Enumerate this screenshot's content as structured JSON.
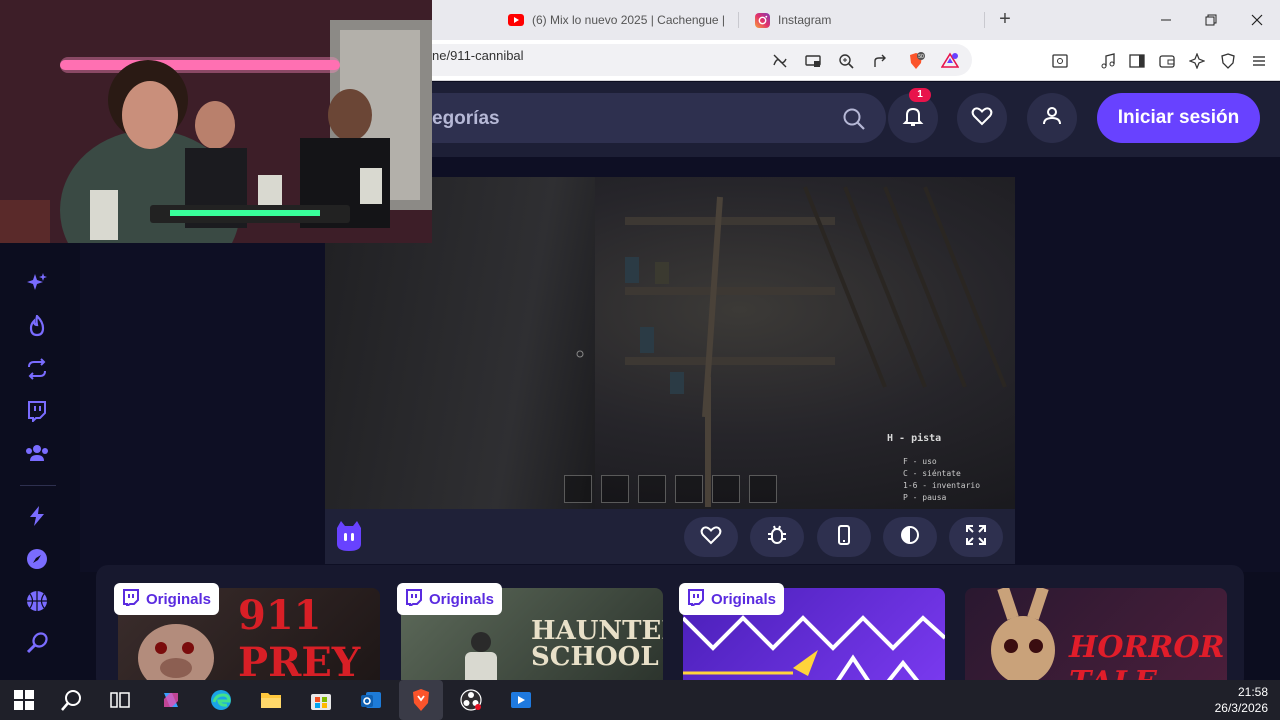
{
  "browser": {
    "tabs": [
      {
        "label": "(6) Mix lo nuevo 2025 | Cachengue |",
        "icon": "youtube-icon"
      },
      {
        "label": "Instagram",
        "icon": "instagram-icon"
      }
    ],
    "url": "ne/911-cannibal",
    "colors": {
      "brave": "#fb542b",
      "youtube": "#ff0000"
    }
  },
  "site": {
    "search_placeholder": "egorías",
    "notification_count": "1",
    "login_label": "Iniciar sesión",
    "accent": "#6842ff"
  },
  "game": {
    "hint_title": "H - pista",
    "hint_lines": [
      "F - uso",
      "C - siéntate",
      "1-6 - inventario",
      "P - pausa"
    ]
  },
  "cards": [
    {
      "badge": "Originals",
      "art_text": "911 PREY",
      "art_color": "#d81f26"
    },
    {
      "badge": "Originals",
      "art_text": "HAUNTED SCHOOL",
      "art_color": "#e8e0c8"
    },
    {
      "badge": "Originals",
      "art_text": "",
      "art_color": "#6a2bd8"
    },
    {
      "badge": "",
      "art_text": "HORROR TALE",
      "art_color": "#e11d2a"
    }
  ],
  "taskbar": {
    "time": "21:58",
    "date": "26/3/2026"
  }
}
